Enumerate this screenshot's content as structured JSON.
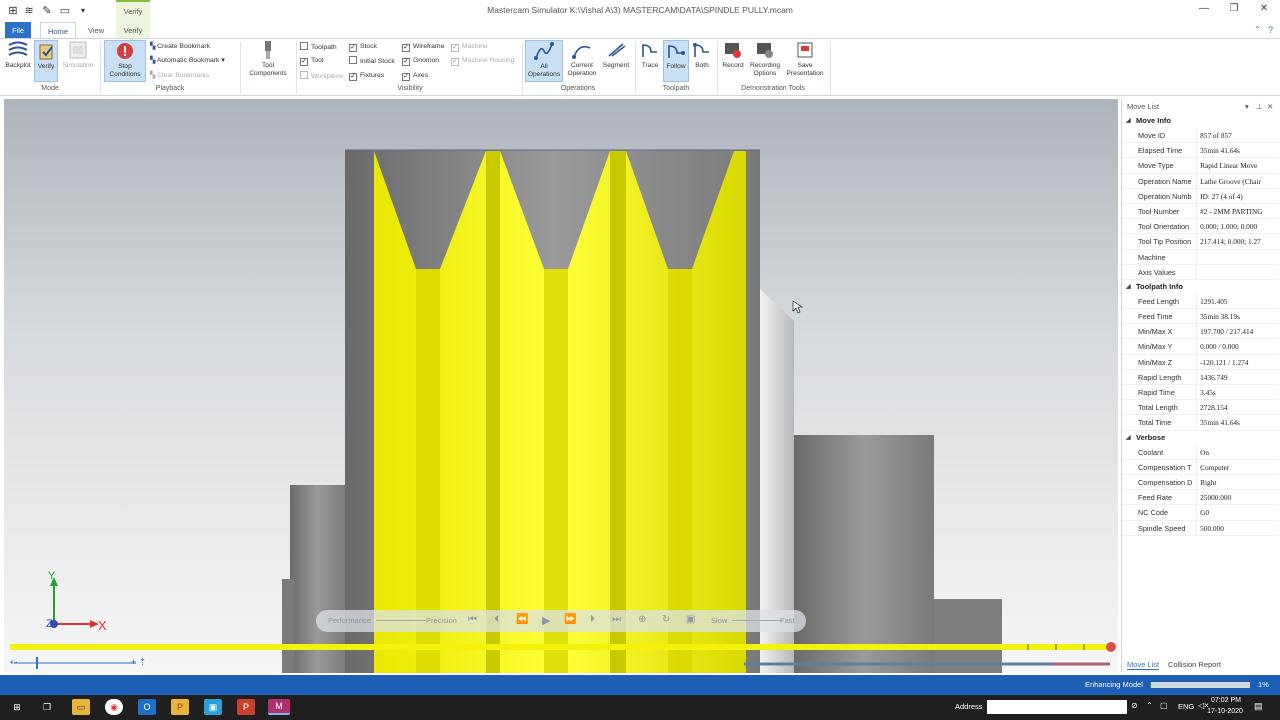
{
  "app": {
    "title": "Mastercam Simulator  K:\\Vishal A\\3) MASTERCAM\\DATA\\SPINDLE PULLY.mcam",
    "context_tab": "Verify",
    "tabs": [
      "File",
      "Home",
      "View",
      "Verify"
    ]
  },
  "ribbon": {
    "mode": {
      "backplot": "Backplot",
      "verify": "Verify",
      "simulation": "Simulation",
      "group": "Mode"
    },
    "playback": {
      "stop_conditions": "Stop\nConditions",
      "create_bookmark": "Create Bookmark",
      "automatic_bookmark": "Automatic Bookmark",
      "clear_bookmarks": "Clear Bookmarks",
      "group": "Playback"
    },
    "tool_components": "Tool\nComponents",
    "visibility": {
      "toolpath": "Toolpath",
      "stock": "Stock",
      "wireframe": "Wireframe",
      "machine": "Machine",
      "tool": "Tool",
      "initial_stock": "Initial Stock",
      "gnomon": "Gnomon",
      "machine_housing": "Machine Housing",
      "workpiece": "Workpiece",
      "fixtures": "Fixtures",
      "axes": "Axes",
      "group": "Visibility"
    },
    "operations": {
      "all": "All\nOperations",
      "current": "Current\nOperation",
      "segment": "Segment",
      "group": "Operations"
    },
    "toolpath": {
      "trace": "Trace",
      "follow": "Follow",
      "both": "Both",
      "group": "Toolpath"
    },
    "demo": {
      "record": "Record",
      "recording_options": "Recording\nOptions",
      "save_presentation": "Save\nPresentation",
      "group": "Demonstration Tools"
    }
  },
  "panel": {
    "header": "Move List",
    "sections": [
      {
        "title": "Move Info",
        "rows": [
          {
            "k": "Move ID",
            "v": "857 of 857"
          },
          {
            "k": "Elapsed Time",
            "v": "35min 41.64s"
          },
          {
            "k": "Move Type",
            "v": "Rapid Linear Move"
          },
          {
            "k": "Operation Name",
            "v": "Lathe Groove (Chair"
          },
          {
            "k": "Operation Numb",
            "v": "ID: 27 (4 of 4)"
          },
          {
            "k": "Tool Number",
            "v": "#2 - 2MM PARTING"
          },
          {
            "k": "Tool Orientation",
            "v": "0.000; 1.000; 0.000"
          },
          {
            "k": "Tool Tip Position",
            "v": "217.414; 0.000; 1.27"
          },
          {
            "k": "Machine",
            "v": ""
          },
          {
            "k": "Axis Values",
            "v": ""
          }
        ]
      },
      {
        "title": "Toolpath Info",
        "rows": [
          {
            "k": "Feed Length",
            "v": "1291.405"
          },
          {
            "k": "Feed Time",
            "v": "35min 38.19s"
          },
          {
            "k": "Min/Max X",
            "v": "197.700 / 217.414"
          },
          {
            "k": "Min/Max Y",
            "v": "0.000 / 0.000"
          },
          {
            "k": "Min/Max Z",
            "v": "-120.121 / 1.274"
          },
          {
            "k": "Rapid Length",
            "v": "1436.749"
          },
          {
            "k": "Rapid Time",
            "v": "3.45s"
          },
          {
            "k": "Total Length",
            "v": "2728.154"
          },
          {
            "k": "Total Time",
            "v": "35min 41.64s"
          }
        ]
      },
      {
        "title": "Verbose",
        "rows": [
          {
            "k": "Coolant",
            "v": "On"
          },
          {
            "k": "Compensation T",
            "v": "Computer"
          },
          {
            "k": "Compensation D",
            "v": "Right"
          },
          {
            "k": "Feed Rate",
            "v": "25000.000"
          },
          {
            "k": "NC Code",
            "v": "G0"
          },
          {
            "k": "Spindle Speed",
            "v": "500.000"
          }
        ]
      }
    ],
    "tabs": [
      "Move List",
      "Collision Report"
    ]
  },
  "playbar": {
    "performance": "Performance",
    "precision": "Precision",
    "slow": "Slow",
    "fast": "Fast"
  },
  "gnomon": {
    "y": "Y",
    "x": "X",
    "z": "Z"
  },
  "status": {
    "label": "Enhancing Model",
    "percent": "1%",
    "progress": 0.01
  },
  "taskbar": {
    "address_label": "Address",
    "lang": "ENG",
    "time": "07:02 PM",
    "date": "17-10-2020"
  },
  "colors": {
    "accent": "#2b73c8",
    "status_bar": "#1c5fb4",
    "toolpath_yellow": "#f2f20a",
    "stock_gray": "#8a8a8a"
  }
}
